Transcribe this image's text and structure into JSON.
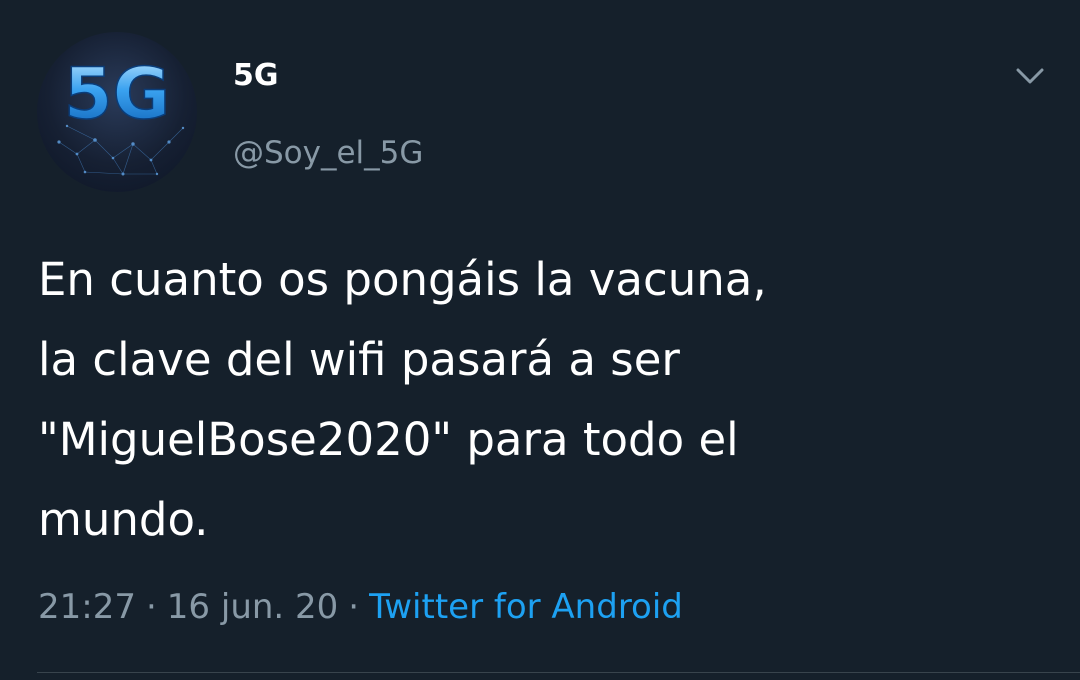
{
  "tweet": {
    "display_name": "5G",
    "handle": "@Soy_el_5G",
    "avatar_text": "5G",
    "text": "En cuanto os pongáis la vacuna,\nla clave del wifi pasará a ser\n\"MiguelBose2020\" para todo el\nmundo.",
    "time": "21:27",
    "date": "16 jun. 20",
    "separator": "·",
    "source": "Twitter for Android"
  },
  "colors": {
    "background": "#15202b",
    "text": "#ffffff",
    "secondary_text": "#8899a6",
    "link": "#1da1f2",
    "divider": "#38444d"
  },
  "icons": {
    "menu": "chevron-down-icon"
  }
}
